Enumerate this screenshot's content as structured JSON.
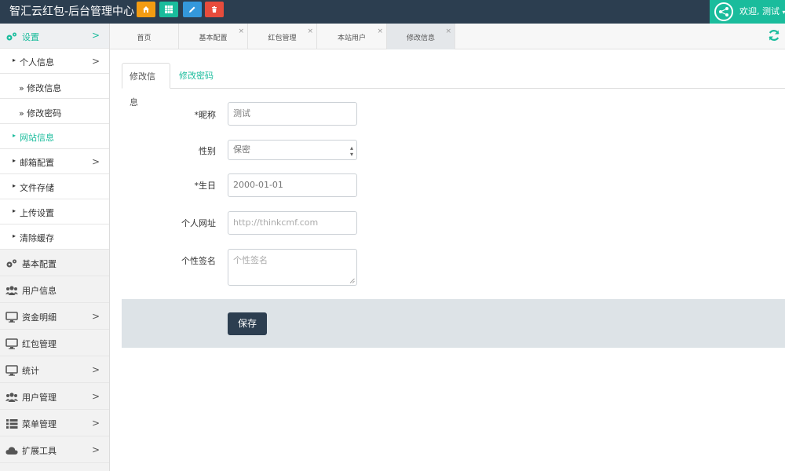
{
  "header": {
    "title": "智汇云红包-后台管理中心",
    "quick_buttons": [
      {
        "icon": "home-icon",
        "color": "#f39c12"
      },
      {
        "icon": "grid-icon",
        "color": "#1abc9c"
      },
      {
        "icon": "pencil-icon",
        "color": "#3498db"
      },
      {
        "icon": "trash-icon",
        "color": "#e74c3c"
      }
    ],
    "welcome": "欢迎, 测试",
    "accent": "#1abc9c",
    "bar_color": "#2c3e50"
  },
  "sidebar": {
    "items": [
      {
        "label": "设置",
        "icon": "gears-icon",
        "arrow": ">"
      },
      {
        "label": "个人信息",
        "arrow": ">"
      },
      {
        "label": "» 修改信息"
      },
      {
        "label": "» 修改密码"
      },
      {
        "label": "网站信息"
      },
      {
        "label": "邮箱配置",
        "arrow": ">"
      },
      {
        "label": "文件存储"
      },
      {
        "label": "上传设置"
      },
      {
        "label": "清除缓存"
      },
      {
        "label": "基本配置",
        "icon": "gears-icon"
      },
      {
        "label": "用户信息",
        "icon": "users-icon"
      },
      {
        "label": "资金明细",
        "icon": "monitor-icon",
        "arrow": ">"
      },
      {
        "label": "红包管理",
        "icon": "monitor-icon"
      },
      {
        "label": "统计",
        "icon": "monitor-icon",
        "arrow": ">"
      },
      {
        "label": "用户管理",
        "icon": "users-icon",
        "arrow": ">"
      },
      {
        "label": "菜单管理",
        "icon": "list-icon",
        "arrow": ">"
      },
      {
        "label": "扩展工具",
        "icon": "cloud-icon",
        "arrow": ">"
      }
    ]
  },
  "page_tabs": [
    {
      "label": "首页"
    },
    {
      "label": "基本配置",
      "close": "×"
    },
    {
      "label": "红包管理",
      "close": "×"
    },
    {
      "label": "本站用户",
      "close": "×"
    },
    {
      "label": "修改信息",
      "close": "×"
    }
  ],
  "content_tabs": {
    "active": "修改信息",
    "other": "修改密码"
  },
  "form": {
    "nickname": {
      "label": "*昵称",
      "value": "测试"
    },
    "gender": {
      "label": "性别",
      "value": "保密"
    },
    "birthday": {
      "label": "*生日",
      "value": "2000-01-01"
    },
    "website": {
      "label": "个人网址",
      "placeholder": "http://thinkcmf.com"
    },
    "signature": {
      "label": "个性签名",
      "placeholder": "个性签名"
    },
    "save_label": "保存"
  }
}
